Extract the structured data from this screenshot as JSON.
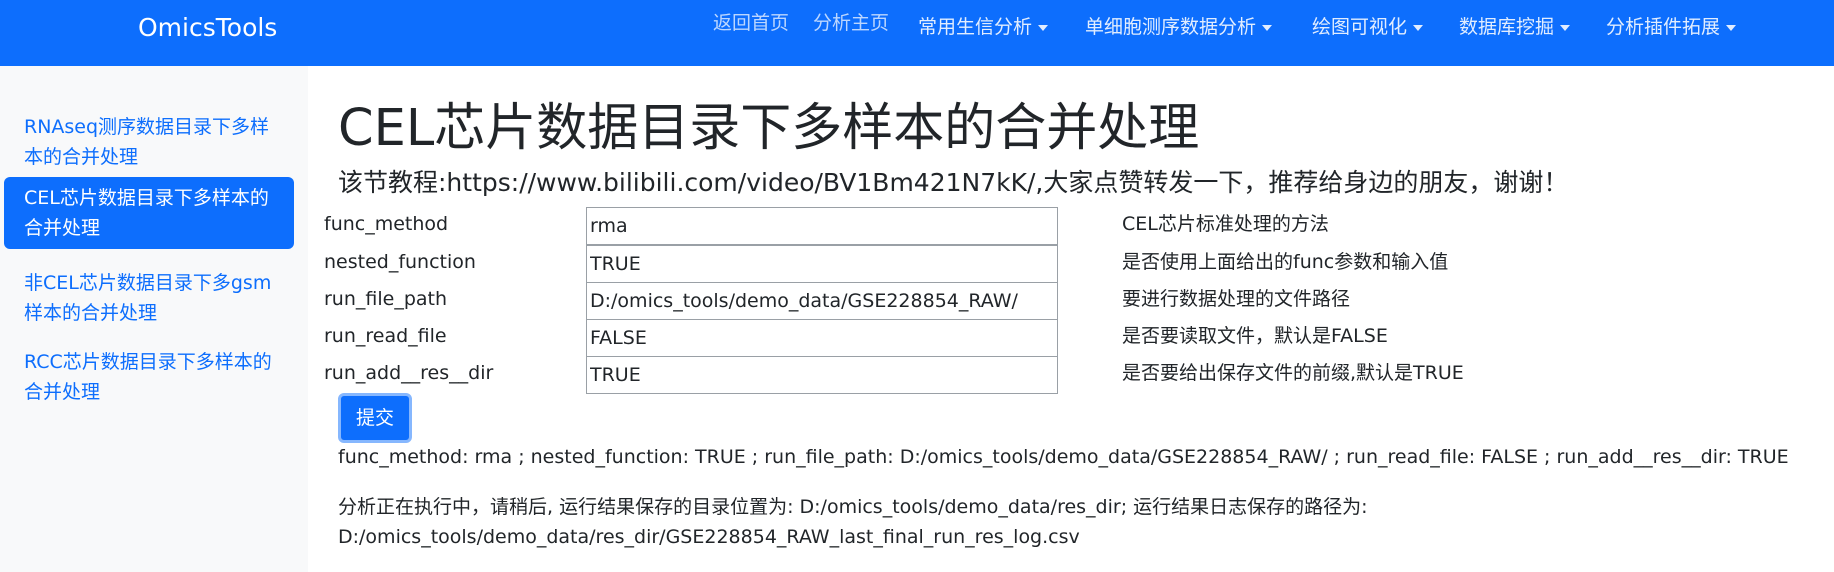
{
  "navbar": {
    "brand": "OmicsTools",
    "links": [
      "返回首页",
      "分析主页"
    ],
    "dropdowns": [
      "常用生信分析",
      "单细胞测序数据分析",
      "绘图可视化",
      "数据库挖掘",
      "分析插件拓展"
    ]
  },
  "sidebar": {
    "items": [
      {
        "label": "RNAseq测序数据目录下多样本的合并处理",
        "active": false
      },
      {
        "label": "CEL芯片数据目录下多样本的合并处理",
        "active": true
      },
      {
        "label": "非CEL芯片数据目录下多gsm样本的合并处理",
        "active": false
      },
      {
        "label": "RCC芯片数据目录下多样本的合并处理",
        "active": false
      }
    ]
  },
  "main": {
    "title": "CEL芯片数据目录下多样本的合并处理",
    "tutorial": "该节教程:https://www.bilibili.com/video/BV1Bm421N7kK/,大家点赞转发一下，推荐给身边的朋友，谢谢！",
    "params": [
      {
        "name": "func_method",
        "value": "rma",
        "desc": "CEL芯片标准处理的方法"
      },
      {
        "name": "nested_function",
        "value": "TRUE",
        "desc": "是否使用上面给出的func参数和输入值"
      },
      {
        "name": "run_file_path",
        "value": "D:/omics_tools/demo_data/GSE228854_RAW/",
        "desc": "要进行数据处理的文件路径"
      },
      {
        "name": "run_read_file",
        "value": "FALSE",
        "desc": "是否要读取文件，默认是FALSE"
      },
      {
        "name": "run_add__res__dir",
        "value": "TRUE",
        "desc": "是否要给出保存文件的前缀,默认是TRUE"
      }
    ],
    "submit_label": "提交",
    "summary": "func_method: rma ; nested_function: TRUE ; run_file_path: D:/omics_tools/demo_data/GSE228854_RAW/ ; run_read_file: FALSE ; run_add__res__dir: TRUE",
    "running_line1": "分析正在执行中，请稍后, 运行结果保存的目录位置为: D:/omics_tools/demo_data/res_dir; 运行结果日志保存的路径为:",
    "running_line2": "D:/omics_tools/demo_data/res_dir/GSE228854_RAW_last_final_run_res_log.csv"
  },
  "colors": {
    "primary": "#0d6efd",
    "sidebar_bg": "#f8f9fa"
  }
}
